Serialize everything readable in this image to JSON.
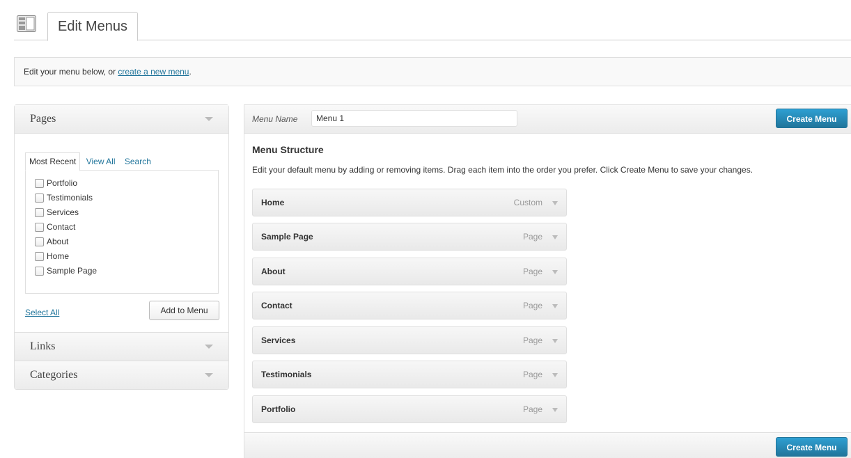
{
  "header": {
    "title": "Edit Menus"
  },
  "notice": {
    "text_prefix": "Edit your menu below, or ",
    "link": "create a new menu",
    "text_suffix": "."
  },
  "sidebar": {
    "pages_title": "Pages",
    "tabs": [
      "Most Recent",
      "View All",
      "Search"
    ],
    "pages": [
      "Portfolio",
      "Testimonials",
      "Services",
      "Contact",
      "About",
      "Home",
      "Sample Page"
    ],
    "select_all": "Select All",
    "add_to_menu": "Add to Menu",
    "links_title": "Links",
    "categories_title": "Categories"
  },
  "menu": {
    "name_label": "Menu Name",
    "name_value": "Menu 1",
    "create_button": "Create Menu",
    "structure_title": "Menu Structure",
    "structure_desc": "Edit your default menu by adding or removing items. Drag each item into the order you prefer. Click Create Menu to save your changes.",
    "items": [
      {
        "title": "Home",
        "type": "Custom"
      },
      {
        "title": "Sample Page",
        "type": "Page"
      },
      {
        "title": "About",
        "type": "Page"
      },
      {
        "title": "Contact",
        "type": "Page"
      },
      {
        "title": "Services",
        "type": "Page"
      },
      {
        "title": "Testimonials",
        "type": "Page"
      },
      {
        "title": "Portfolio",
        "type": "Page"
      }
    ]
  },
  "colors": {
    "link": "#21759b",
    "primary_button": "#21759b"
  },
  "icons": {
    "header": "menus-screen-icon",
    "collapse": "triangle-down-icon"
  }
}
